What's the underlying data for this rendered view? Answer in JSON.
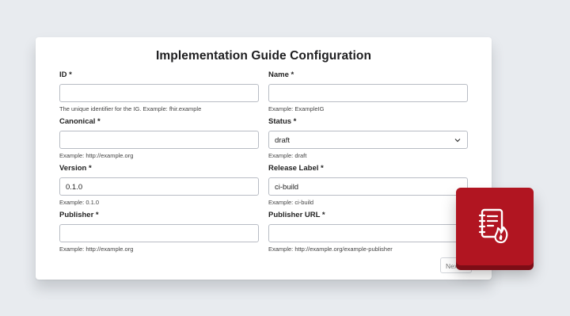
{
  "title": "Implementation Guide Configuration",
  "fields": {
    "id": {
      "label": "ID *",
      "value": "",
      "hint": "The unique identifier for the IG. Example: fhir.example"
    },
    "name": {
      "label": "Name *",
      "value": "",
      "hint": "Example: ExampleIG"
    },
    "canonical": {
      "label": "Canonical *",
      "value": "",
      "hint": "Example: http://example.org"
    },
    "status": {
      "label": "Status *",
      "value": "draft",
      "hint": "Example: draft"
    },
    "version": {
      "label": "Version *",
      "value": "0.1.0",
      "hint": "Example: 0.1.0"
    },
    "release_label": {
      "label": "Release Label *",
      "value": "ci-build",
      "hint": "Example: ci-build"
    },
    "publisher": {
      "label": "Publisher *",
      "value": "",
      "hint": "Example: http://example.org"
    },
    "publisher_url": {
      "label": "Publisher URL *",
      "value": "",
      "hint": "Example: http://example.org/example-publisher"
    }
  },
  "next_label": "Next",
  "badge_icon": "notebook-flame-icon",
  "colors": {
    "badge": "#b11521",
    "background": "#e8ebef"
  }
}
